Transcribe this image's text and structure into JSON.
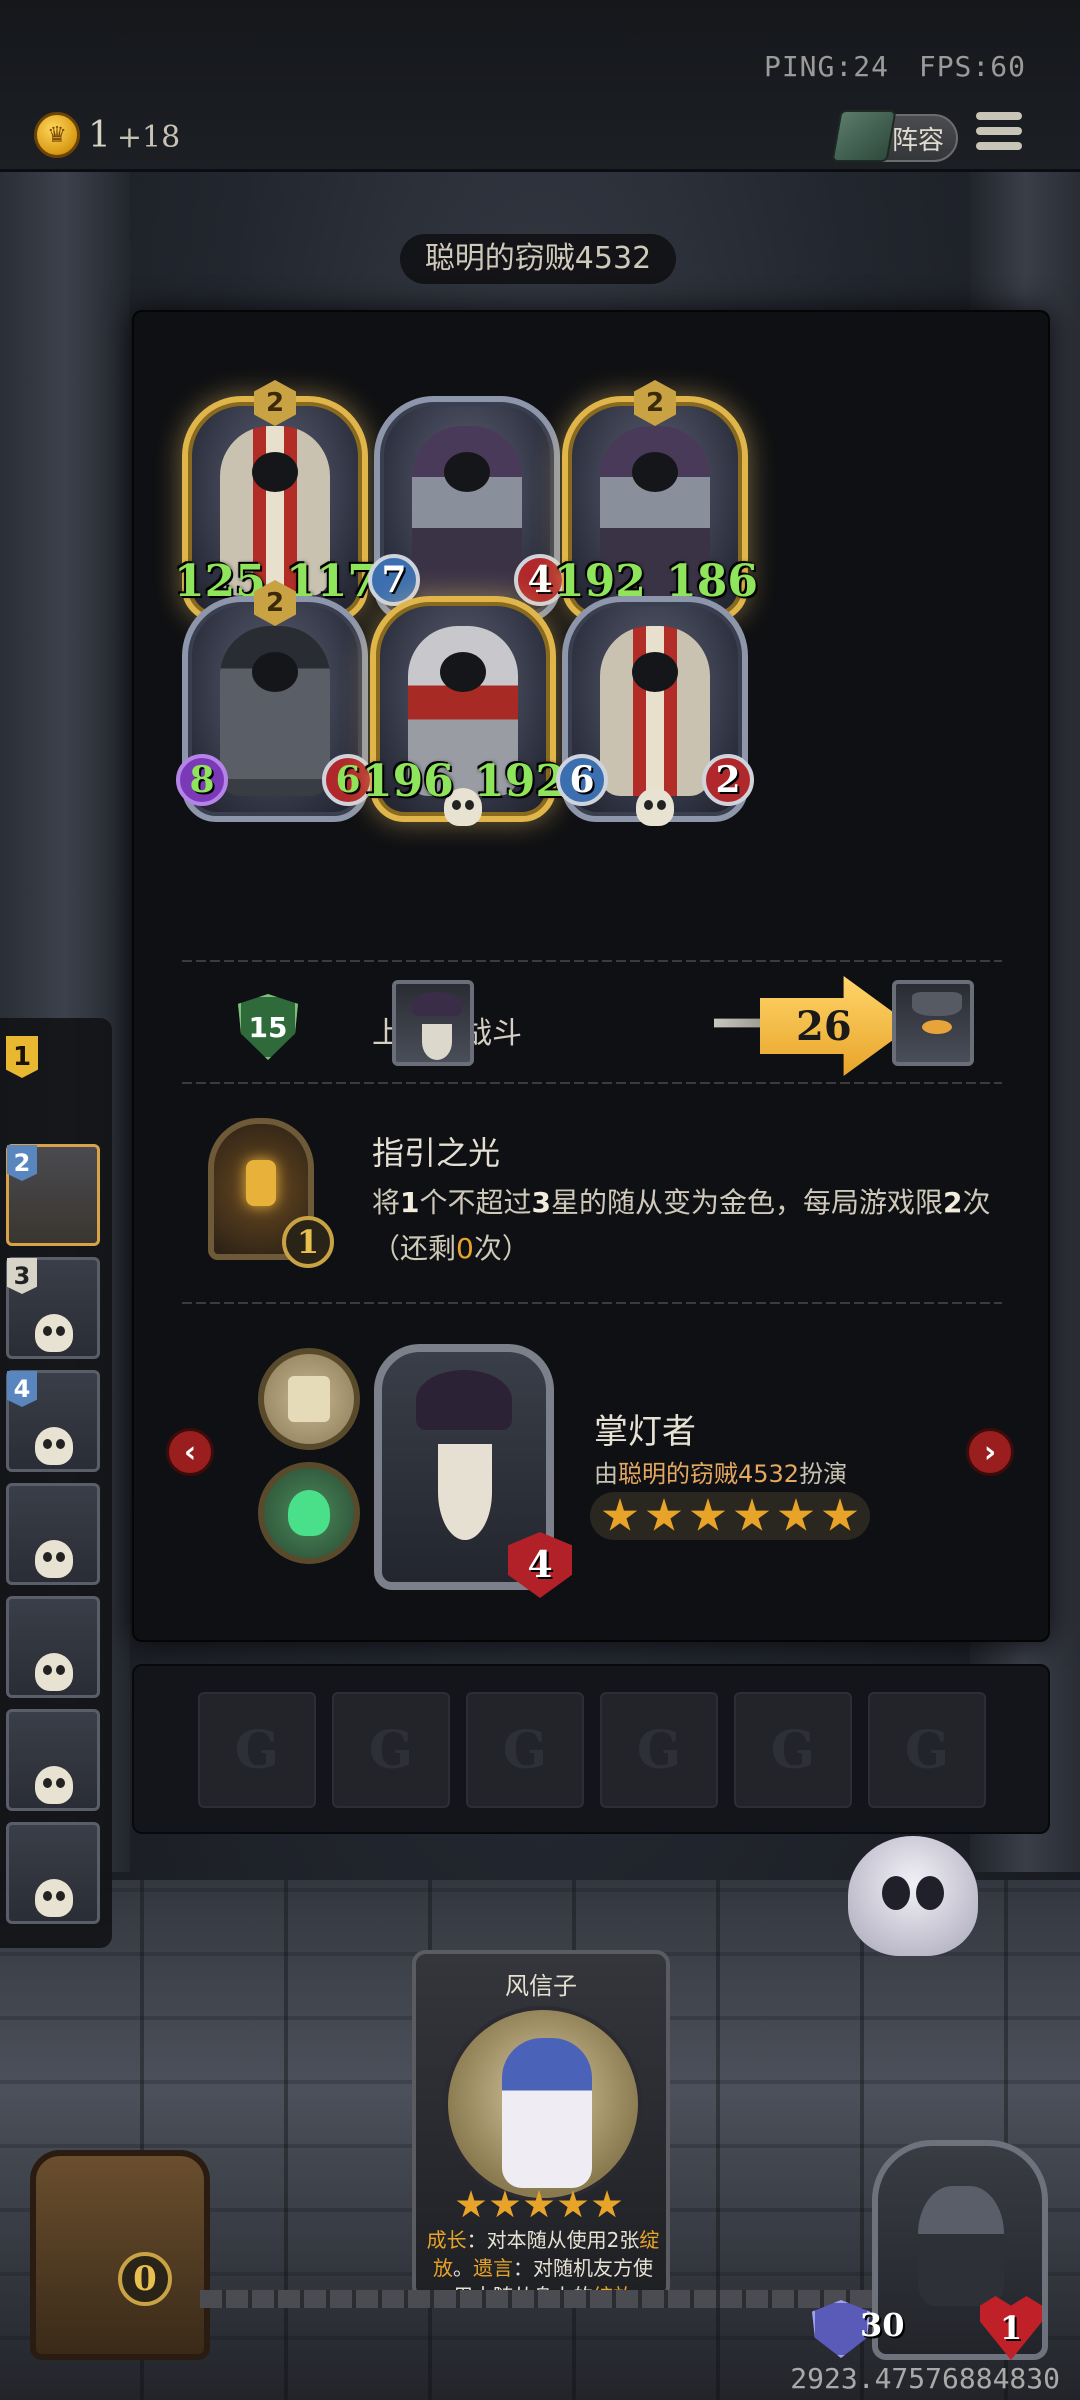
{
  "hud": {
    "ping": "PING:24",
    "fps": "FPS:60",
    "coins": "1",
    "coins_income": "+18",
    "lineup_label": "阵容"
  },
  "opponent": {
    "name": "聪明的窃贼4532"
  },
  "board": {
    "minions": [
      {
        "tier": "2",
        "attack": "125",
        "health": "117",
        "golden": true,
        "style": "paladin",
        "stat_style": "buffed",
        "deathrattle": true
      },
      {
        "tier": "",
        "attack": "7",
        "health": "4",
        "golden": false,
        "style": "rogue",
        "stat_style": "badge",
        "deathrattle": false
      },
      {
        "tier": "2",
        "attack": "192",
        "health": "186",
        "golden": true,
        "style": "rogue",
        "stat_style": "buffed",
        "deathrattle": false
      },
      {
        "tier": "2",
        "attack": "8",
        "health": "6",
        "golden": false,
        "style": "shield",
        "stat_style": "badge-buff",
        "deathrattle": false
      },
      {
        "tier": "",
        "attack": "196",
        "health": "192",
        "golden": true,
        "style": "knight",
        "stat_style": "buffed",
        "deathrattle": true
      },
      {
        "tier": "",
        "attack": "6",
        "health": "2",
        "golden": false,
        "style": "paladin",
        "stat_style": "badge",
        "deathrattle": true
      }
    ]
  },
  "last_battle": {
    "tavern_tier": "15",
    "label": "上一场战斗",
    "damage": "26"
  },
  "hero_power": {
    "name": "指引之光",
    "desc_parts": [
      "将",
      "1",
      "个不超过",
      "3",
      "星的随从变为金色，每局游戏限",
      "2",
      "次（还剩",
      "0",
      "次）"
    ],
    "uses_left": "1"
  },
  "hero": {
    "name": "掌灯者",
    "played_by_prefix": "由",
    "played_by_player": "聪明的窃贼4532",
    "played_by_suffix": "扮演",
    "armor": "4",
    "stars": 6,
    "prev_icon": "chevron-left-icon",
    "next_icon": "chevron-right-icon"
  },
  "leaderboard": {
    "first_rank": "1",
    "entries": [
      {
        "rank": "2",
        "current": true,
        "eliminated": false,
        "rank_color": "blue"
      },
      {
        "rank": "3",
        "current": false,
        "eliminated": true,
        "rank_color": "white"
      },
      {
        "rank": "4",
        "current": false,
        "eliminated": true,
        "rank_color": "blue"
      },
      {
        "rank": "",
        "current": false,
        "eliminated": true,
        "rank_color": "none"
      },
      {
        "rank": "",
        "current": false,
        "eliminated": true,
        "rank_color": "none"
      },
      {
        "rank": "",
        "current": false,
        "eliminated": true,
        "rank_color": "none"
      },
      {
        "rank": "",
        "current": false,
        "eliminated": true,
        "rank_color": "none"
      }
    ]
  },
  "shop": {
    "slots": 6
  },
  "hand_card": {
    "name": "风信子",
    "stars": 5,
    "text_parts": [
      {
        "t": "成长",
        "kw": true
      },
      {
        "t": "：对本随从使用",
        "kw": false
      },
      {
        "t": "2",
        "kw": false
      },
      {
        "t": "张",
        "kw": false
      },
      {
        "t": "绽放",
        "kw": true
      },
      {
        "t": "。",
        "kw": false
      },
      {
        "t": "遗言",
        "kw": true
      },
      {
        "t": "：对随机友方",
        "kw": false
      },
      {
        "t": "使用本随从身上的",
        "kw": false
      },
      {
        "t": "绽放",
        "kw": true
      }
    ]
  },
  "player": {
    "chest_count": "0",
    "armor": "30",
    "health": "1",
    "coordinates": "2923.47576884830"
  },
  "colors": {
    "gold": "#e8a428",
    "buff_green": "#8ee45a",
    "health_red": "#b0282c",
    "attack_blue": "#3b6fb0"
  }
}
